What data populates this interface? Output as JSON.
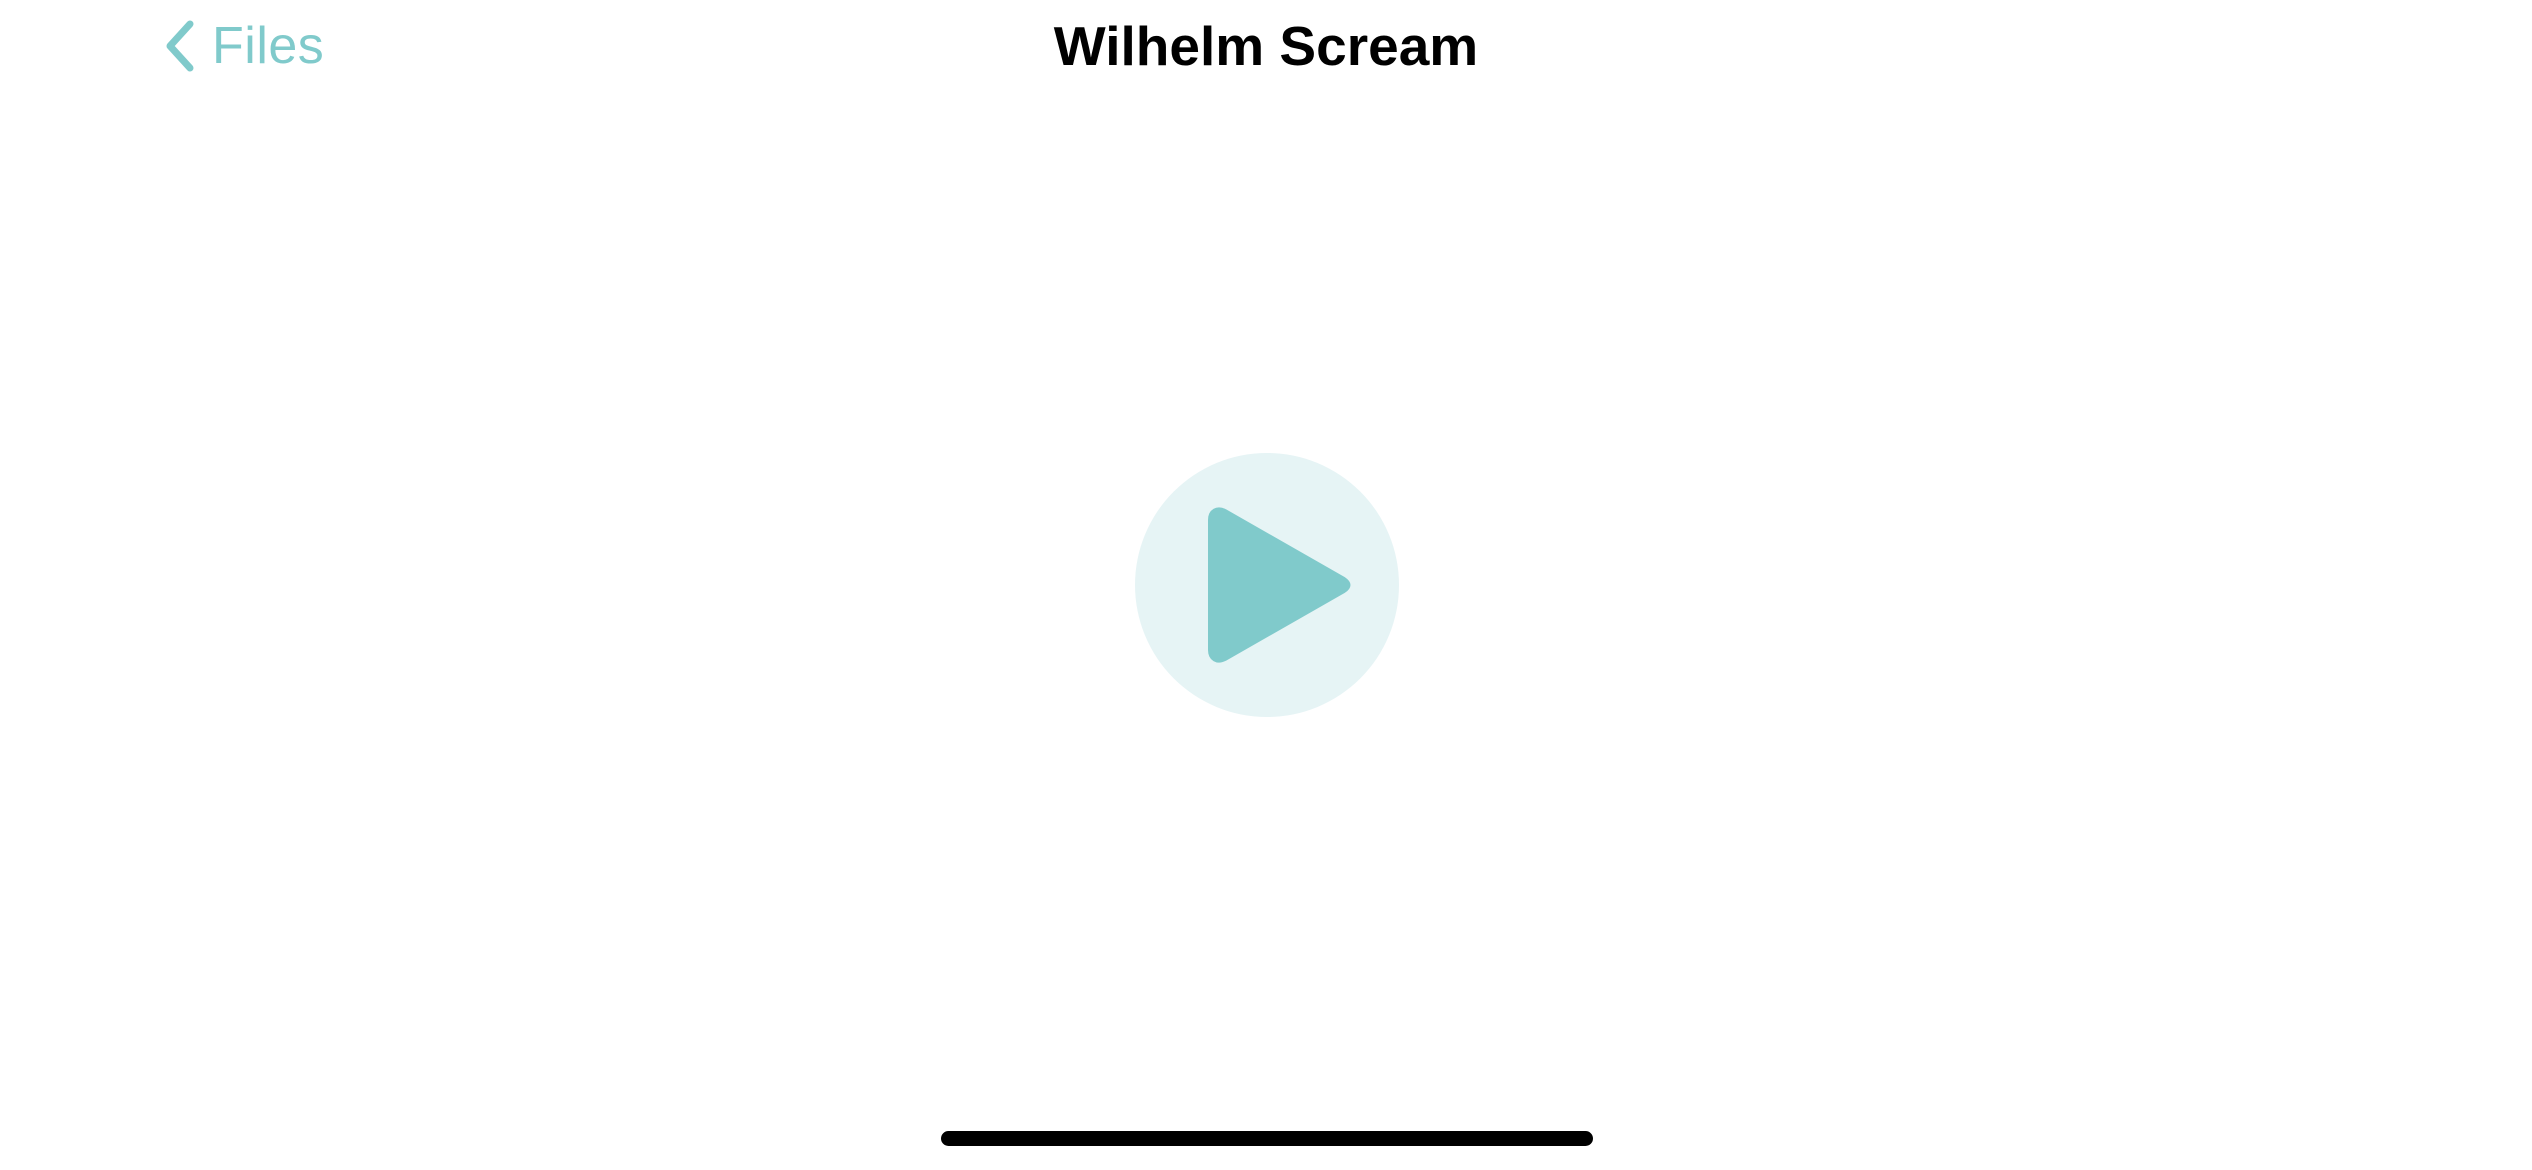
{
  "nav": {
    "back_label": "Files",
    "back_icon": "chevron-left-icon",
    "title": "Wilhelm Scream"
  },
  "player": {
    "play_icon": "play-icon",
    "button_color": "#e6f4f5",
    "icon_color": "#80cacb"
  },
  "colors": {
    "accent": "#80cacb",
    "title": "#000000",
    "background": "#ffffff"
  }
}
